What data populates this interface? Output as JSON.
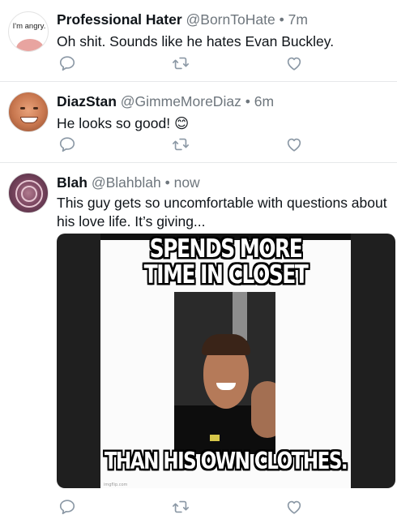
{
  "tweets": [
    {
      "avatar_text": "I'm angry.",
      "name": "Professional Hater",
      "handle": "@BornToHate",
      "separator": "•",
      "time": "7m",
      "text": "Oh shit. Sounds like he hates Evan Buckley."
    },
    {
      "name": "DiazStan",
      "handle": "@GimmeMoreDiaz",
      "separator": "•",
      "time": "6m",
      "text": "He looks so good! 😊"
    },
    {
      "name": "Blah",
      "handle": "@Blahblah",
      "separator": "•",
      "time": "now",
      "text": "This guy gets so uncomfortable with questions about his love life. It’s giving...",
      "meme": {
        "top_line_1": "SPENDS MORE",
        "top_line_2": "TIME IN CLOSET",
        "bottom_line": "THAN HIS OWN CLOTHES.",
        "watermark": "imgflip.com"
      }
    }
  ],
  "actions": {
    "reply_icon": "reply-icon",
    "retweet_icon": "retweet-icon",
    "like_icon": "heart-icon"
  },
  "colors": {
    "text": "#0f1419",
    "secondary": "#6e767d",
    "icon": "#8b98a5",
    "divider": "#e6e8ea"
  }
}
